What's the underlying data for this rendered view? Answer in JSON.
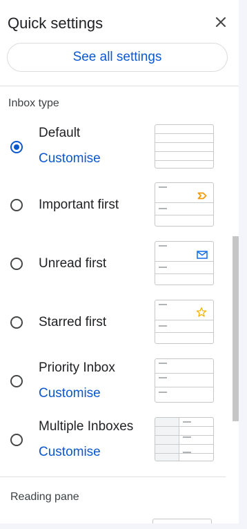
{
  "header": {
    "title": "Quick settings",
    "close_icon": "close-icon"
  },
  "see_all_button": "See all settings",
  "inbox_type": {
    "label": "Inbox type",
    "selected": "Default",
    "options": [
      {
        "label": "Default",
        "customise": "Customise",
        "checked": true,
        "thumb_icon": ""
      },
      {
        "label": "Important first",
        "customise": "",
        "checked": false,
        "thumb_icon": "important-marker-icon"
      },
      {
        "label": "Unread first",
        "customise": "",
        "checked": false,
        "thumb_icon": "envelope-icon"
      },
      {
        "label": "Starred first",
        "customise": "",
        "checked": false,
        "thumb_icon": "star-icon"
      },
      {
        "label": "Priority Inbox",
        "customise": "Customise",
        "checked": false,
        "thumb_icon": ""
      },
      {
        "label": "Multiple Inboxes",
        "customise": "Customise",
        "checked": false,
        "thumb_icon": ""
      }
    ]
  },
  "reading_pane": {
    "label": "Reading pane"
  },
  "colors": {
    "accent": "#0b57d0",
    "important": "#f29900",
    "star": "#f4b400",
    "envelope": "#1a73e8"
  }
}
